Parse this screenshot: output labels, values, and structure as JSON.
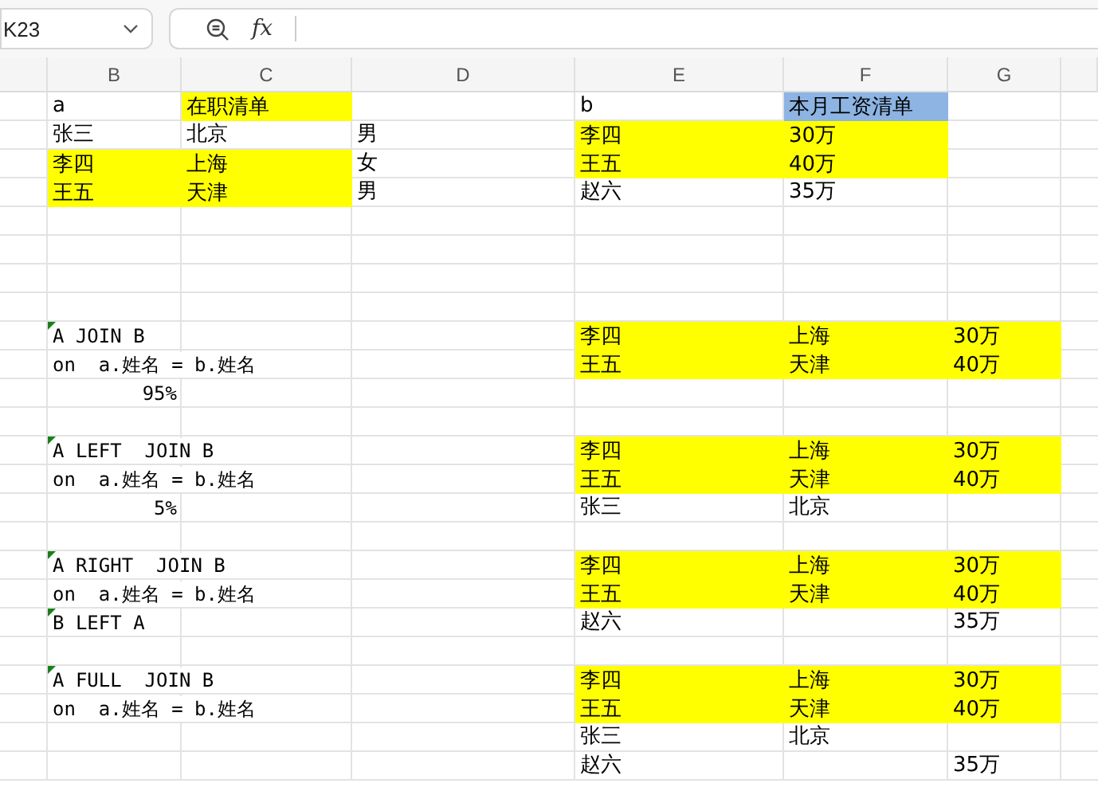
{
  "name_box": {
    "value": "K23"
  },
  "formula_bar": {
    "function_label": "fx"
  },
  "columns": [
    "B",
    "C",
    "D",
    "E",
    "F",
    "G"
  ],
  "rows": [
    {
      "cells": [
        {
          "text": "a",
          "kind": "text"
        },
        {
          "text": "在职清单",
          "kind": "text",
          "color": "#ffff00"
        },
        {},
        {
          "text": "b",
          "kind": "text"
        },
        {
          "text": "本月工资清单",
          "kind": "text",
          "color": "#8db4e2"
        }
      ]
    },
    {
      "cells": [
        {
          "text": "张三",
          "kind": "text"
        },
        {
          "text": "北京",
          "kind": "text"
        },
        {
          "text": "男",
          "kind": "text"
        },
        {
          "text": "李四",
          "kind": "text",
          "color": "#ffff00"
        },
        {
          "text": "30万",
          "kind": "text",
          "color": "#ffff00"
        }
      ]
    },
    {
      "cells": [
        {
          "text": "李四",
          "kind": "text",
          "color": "#ffff00"
        },
        {
          "text": "上海",
          "kind": "text",
          "color": "#ffff00"
        },
        {
          "text": "女",
          "kind": "text"
        },
        {
          "text": "王五",
          "kind": "text",
          "color": "#ffff00"
        },
        {
          "text": "40万",
          "kind": "text",
          "color": "#ffff00"
        }
      ]
    },
    {
      "cells": [
        {
          "text": "王五",
          "kind": "text",
          "color": "#ffff00"
        },
        {
          "text": "天津",
          "kind": "text",
          "color": "#ffff00"
        },
        {
          "text": "男",
          "kind": "text"
        },
        {
          "text": "赵六",
          "kind": "text"
        },
        {
          "text": "35万",
          "kind": "text"
        }
      ]
    },
    {},
    {},
    {},
    {},
    {
      "cells": [
        {
          "text": "A JOIN B",
          "kind": "code",
          "marker": true
        },
        {},
        {},
        {
          "text": "李四",
          "kind": "text",
          "color": "#ffff00"
        },
        {
          "text": "上海",
          "kind": "text",
          "color": "#ffff00"
        },
        {
          "text": "30万",
          "kind": "text",
          "color": "#ffff00"
        }
      ]
    },
    {
      "cells": [
        {
          "text": "on  a.姓名 = b.姓名",
          "kind": "code"
        },
        {},
        {},
        {
          "text": "王五",
          "kind": "text",
          "color": "#ffff00"
        },
        {
          "text": "天津",
          "kind": "text",
          "color": "#ffff00"
        },
        {
          "text": "40万",
          "kind": "text",
          "color": "#ffff00"
        }
      ]
    },
    {
      "cells": [
        {
          "text": "95%",
          "kind": "number"
        }
      ]
    },
    {},
    {
      "cells": [
        {
          "text": "A LEFT  JOIN B",
          "kind": "code",
          "marker": true
        },
        {},
        {},
        {
          "text": "李四",
          "kind": "text",
          "color": "#ffff00"
        },
        {
          "text": "上海",
          "kind": "text",
          "color": "#ffff00"
        },
        {
          "text": "30万",
          "kind": "text",
          "color": "#ffff00"
        }
      ]
    },
    {
      "cells": [
        {
          "text": "on  a.姓名 = b.姓名",
          "kind": "code"
        },
        {},
        {},
        {
          "text": "王五",
          "kind": "text",
          "color": "#ffff00"
        },
        {
          "text": "天津",
          "kind": "text",
          "color": "#ffff00"
        },
        {
          "text": "40万",
          "kind": "text",
          "color": "#ffff00"
        }
      ]
    },
    {
      "cells": [
        {
          "text": "5%",
          "kind": "number"
        },
        {},
        {},
        {
          "text": "张三",
          "kind": "text"
        },
        {
          "text": "北京",
          "kind": "text"
        }
      ]
    },
    {},
    {
      "cells": [
        {
          "text": "A RIGHT  JOIN B",
          "kind": "code",
          "marker": true
        },
        {},
        {},
        {
          "text": "李四",
          "kind": "text",
          "color": "#ffff00"
        },
        {
          "text": "上海",
          "kind": "text",
          "color": "#ffff00"
        },
        {
          "text": "30万",
          "kind": "text",
          "color": "#ffff00"
        }
      ]
    },
    {
      "cells": [
        {
          "text": "on  a.姓名 = b.姓名",
          "kind": "code"
        },
        {},
        {},
        {
          "text": "王五",
          "kind": "text",
          "color": "#ffff00"
        },
        {
          "text": "天津",
          "kind": "text",
          "color": "#ffff00"
        },
        {
          "text": "40万",
          "kind": "text",
          "color": "#ffff00"
        }
      ]
    },
    {
      "cells": [
        {
          "text": "B LEFT A",
          "kind": "code",
          "marker": true
        },
        {},
        {},
        {
          "text": "赵六",
          "kind": "text"
        },
        {},
        {
          "text": "35万",
          "kind": "text"
        }
      ]
    },
    {},
    {
      "cells": [
        {
          "text": "A FULL  JOIN B",
          "kind": "code",
          "marker": true
        },
        {},
        {},
        {
          "text": "李四",
          "kind": "text",
          "color": "#ffff00"
        },
        {
          "text": "上海",
          "kind": "text",
          "color": "#ffff00"
        },
        {
          "text": "30万",
          "kind": "text",
          "color": "#ffff00"
        }
      ]
    },
    {
      "cells": [
        {
          "text": "on  a.姓名 = b.姓名",
          "kind": "code"
        },
        {},
        {},
        {
          "text": "王五",
          "kind": "text",
          "color": "#ffff00"
        },
        {
          "text": "天津",
          "kind": "text",
          "color": "#ffff00"
        },
        {
          "text": "40万",
          "kind": "text",
          "color": "#ffff00"
        }
      ]
    },
    {
      "cells": [
        {},
        {},
        {},
        {
          "text": "张三",
          "kind": "text"
        },
        {
          "text": "北京",
          "kind": "text"
        }
      ]
    },
    {
      "cells": [
        {},
        {},
        {},
        {
          "text": "赵六",
          "kind": "text"
        },
        {},
        {
          "text": "35万",
          "kind": "text"
        }
      ]
    }
  ]
}
